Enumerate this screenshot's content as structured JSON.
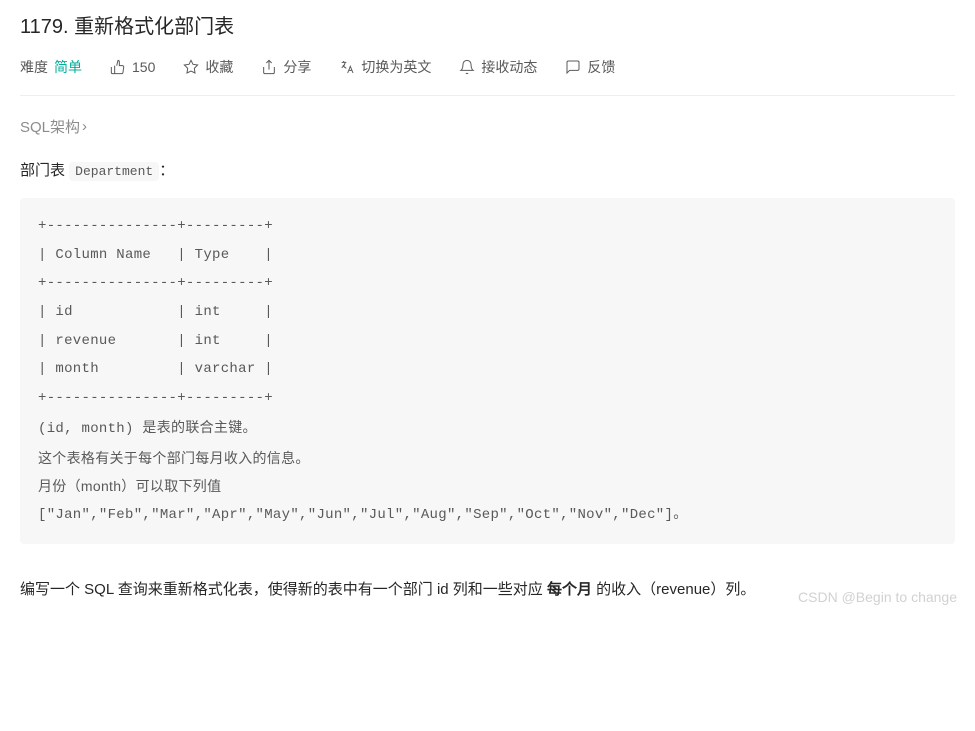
{
  "title": "1179. 重新格式化部门表",
  "meta": {
    "difficulty_label": "难度",
    "difficulty_value": "简单",
    "likes": "150",
    "favorite": "收藏",
    "share": "分享",
    "translate": "切换为英文",
    "subscribe": "接收动态",
    "feedback": "反馈"
  },
  "schema_link": "SQL架构",
  "description": {
    "prefix": "部门表 ",
    "table_name": "Department",
    "suffix": "："
  },
  "code_block": {
    "lines": [
      "+---------------+---------+",
      "| Column Name   | Type    |",
      "+---------------+---------+",
      "| id            | int     |",
      "| revenue       | int     |",
      "| month         | varchar |",
      "+---------------+---------+"
    ],
    "note1_prefix": "(id, month) ",
    "note1_suffix": "是表的联合主键。",
    "note2": "这个表格有关于每个部门每月收入的信息。",
    "note3": "月份（month）可以取下列值",
    "note4": "[\"Jan\",\"Feb\",\"Mar\",\"Apr\",\"May\",\"Jun\",\"Jul\",\"Aug\",\"Sep\",\"Oct\",\"Nov\",\"Dec\"]。"
  },
  "paragraph": {
    "p1": "编写一个 SQL 查询来重新格式化表，使得新的表中有一个部门 id 列和一些对应 ",
    "bold": "每个月",
    "p2": " 的收入（revenue）列。"
  },
  "watermark": "CSDN @Begin to change"
}
